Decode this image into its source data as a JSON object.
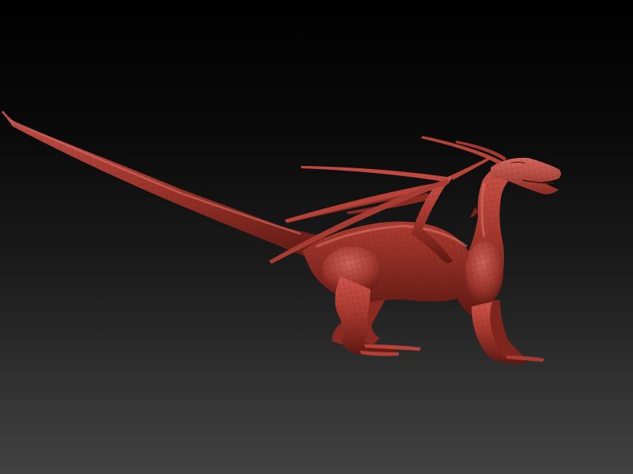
{
  "scene": {
    "subject": "dragon-sculpt",
    "background": {
      "top": "#000000",
      "bottom": "#424242"
    },
    "material": {
      "base": "#a8392f",
      "highlight": "#d8625a",
      "shadow": "#5e1812",
      "wire": "#7a2019"
    },
    "display": "wireframe-mesh-overlay"
  }
}
